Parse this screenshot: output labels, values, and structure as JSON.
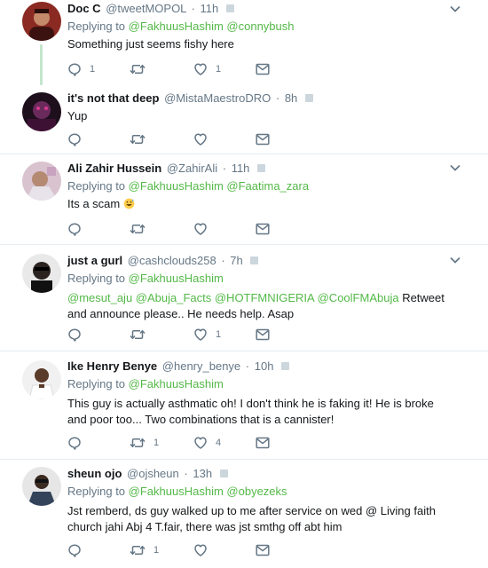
{
  "colors": {
    "accent_green": "#54b948",
    "muted_gray": "#657786",
    "text": "#14171a",
    "divider": "#e6ecf0",
    "thread_line": "#c4e6cc"
  },
  "icons": [
    "reply-icon",
    "retweet-icon",
    "like-icon",
    "direct-message-icon",
    "chevron-down-icon",
    "verified-badge-icon"
  ],
  "tweets": [
    {
      "name": "Doc C",
      "handle": "@tweetMOPOL",
      "time": "11h",
      "reply_label": "Replying to",
      "reply_mentions": "@FakhuusHashim @connybush",
      "text": "Something just seems fishy here",
      "reply_count": "1",
      "retweet_count": "",
      "like_count": "1"
    },
    {
      "name": "it's not that deep",
      "handle": "@MistaMaestroDRO",
      "time": "8h",
      "text": "Yup",
      "reply_count": "",
      "retweet_count": "",
      "like_count": ""
    },
    {
      "name": "Ali Zahir Hussein",
      "handle": "@ZahirAli",
      "time": "11h",
      "reply_label": "Replying to",
      "reply_mentions": "@FakhuusHashim @Faatima_zara",
      "text": "Its a scam",
      "reply_count": "",
      "retweet_count": "",
      "like_count": ""
    },
    {
      "name": "just a gurl",
      "handle": "@cashclouds258",
      "time": "7h",
      "reply_label": "Replying to",
      "reply_mentions": "@FakhuusHashim",
      "text_mentions": "@mesut_aju @Abuja_Facts  @HOTFMNIGERIA @CoolFMAbuja",
      "text": " Retweet and announce please.. He needs help. Asap",
      "reply_count": "",
      "retweet_count": "",
      "like_count": "1"
    },
    {
      "name": "Ike Henry Benye",
      "handle": "@henry_benye",
      "time": "10h",
      "reply_label": "Replying to",
      "reply_mentions": "@FakhuusHashim",
      "text": "This guy is actually asthmatic oh! I don't think he is faking it! He is broke and poor too... Two combinations that is a cannister!",
      "reply_count": "",
      "retweet_count": "1",
      "like_count": "4"
    },
    {
      "name": "sheun ojo",
      "handle": "@ojsheun",
      "time": "13h",
      "reply_label": "Replying to",
      "reply_mentions": "@FakhuusHashim @obyezeks",
      "text": "Jst remberd, ds guy walked up to me after service on wed @ Living faith church jahi Abj 4 T.fair, there was jst smthg off abt him",
      "reply_count": "",
      "retweet_count": "1",
      "like_count": ""
    }
  ]
}
